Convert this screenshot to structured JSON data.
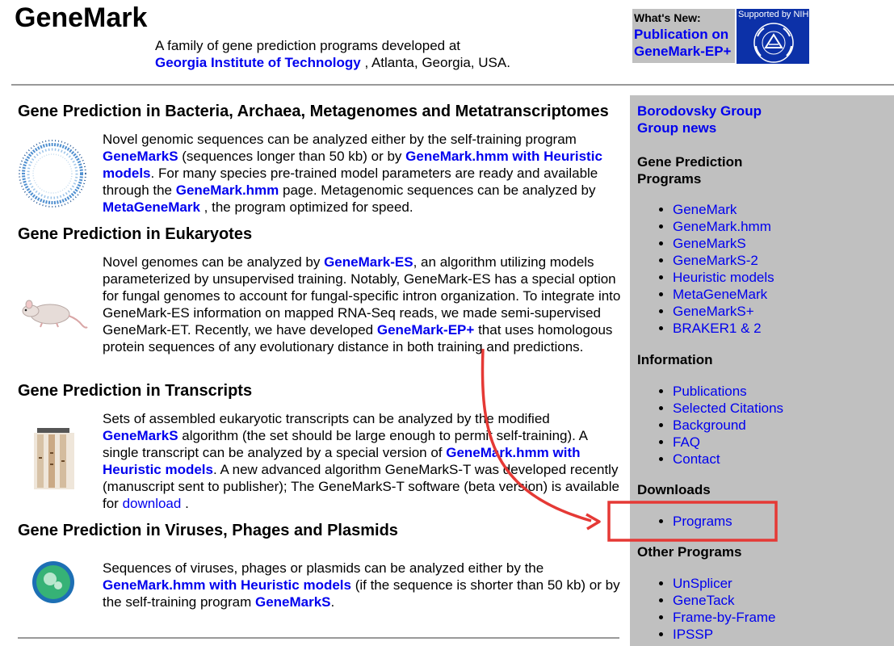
{
  "header": {
    "title": "GeneMark",
    "tagline_line1": "A family of gene prediction programs developed at",
    "institute_link": "Georgia Institute of Technology",
    "tagline_location": ", Atlanta, Georgia, USA."
  },
  "whats_new": {
    "label": "What's New:",
    "link_line1": "Publication on",
    "link_line2": "GeneMark-EP+"
  },
  "nih_banner": {
    "text": "Supported by NIH",
    "seal_text": "NATIONAL INSTITUTES OF HEALTH"
  },
  "sections": {
    "bacteria": {
      "heading": "Gene Prediction in Bacteria, Archaea, Metagenomes and Metatranscriptomes",
      "t1": "Novel genomic sequences can be analyzed either by the self-training program ",
      "l1": "GeneMarkS",
      "t2": " (sequences longer than 50 kb) or by ",
      "l2": "GeneMark.hmm with Heuristic models",
      "t3": ". For many species pre-trained model parameters are ready and available through the ",
      "l3": "GeneMark.hmm",
      "t4": " page. Metagenomic sequences can be analyzed by ",
      "l4": "MetaGeneMark",
      "t5": " , the program optimized for speed."
    },
    "eukaryotes": {
      "heading": "Gene Prediction in Eukaryotes",
      "t1": "Novel genomes can be analyzed by ",
      "l1": "GeneMark-ES",
      "t2": ", an algorithm utilizing models parameterized by unsupervised training. Notably, GeneMark-ES has a special option for fungal genomes to account for fungal-specific intron organization. To integrate into GeneMark-ES information on mapped RNA-Seq reads, we made semi-supervised GeneMark-ET. Recently, we have developed ",
      "l2": "GeneMark-EP+",
      "t3": " that uses homologous protein sequences of any evolutionary distance in both training and predictions."
    },
    "transcripts": {
      "heading": "Gene Prediction in Transcripts",
      "t1": "Sets of assembled eukaryotic transcripts can be analyzed by the modified ",
      "l1": "GeneMarkS",
      "t2": " algorithm (the set should be large enough to permit self-training). A single transcript can be analyzed by a special version of ",
      "l2": "GeneMark.hmm with Heuristic models",
      "t3": ". A new advanced algorithm GeneMarkS-T was developed recently (manuscript sent to publisher); The GeneMarkS-T software (beta version) is available for ",
      "l3": "download",
      "t4": " ."
    },
    "viruses": {
      "heading": "Gene Prediction in Viruses, Phages and Plasmids",
      "t1": "Sequences of viruses, phages or plasmids can be analyzed either by the ",
      "l1": "GeneMark.hmm with Heuristic models",
      "t2": " (if the sequence is shorter than 50 kb) or by the self-training program ",
      "l2": "GeneMarkS",
      "t3": "."
    }
  },
  "sidebar": {
    "top_links": [
      "Borodovsky Group",
      "Group news"
    ],
    "gene_prediction": {
      "heading": "Gene Prediction Programs",
      "items": [
        "GeneMark",
        "GeneMark.hmm",
        "GeneMarkS",
        "GeneMarkS-2",
        "Heuristic models",
        "MetaGeneMark",
        "GeneMarkS+",
        "BRAKER1 & 2"
      ]
    },
    "information": {
      "heading": "Information",
      "items": [
        "Publications",
        "Selected Citations",
        "Background",
        "FAQ",
        "Contact"
      ]
    },
    "downloads": {
      "heading": "Downloads",
      "items": [
        "Programs"
      ]
    },
    "other_programs": {
      "heading": "Other Programs",
      "items": [
        "UnSplicer",
        "GeneTack",
        "Frame-by-Frame",
        "IPSSP"
      ]
    }
  },
  "annotation": {
    "arrow_color": "#e53935",
    "highlight_color": "#e53935"
  }
}
